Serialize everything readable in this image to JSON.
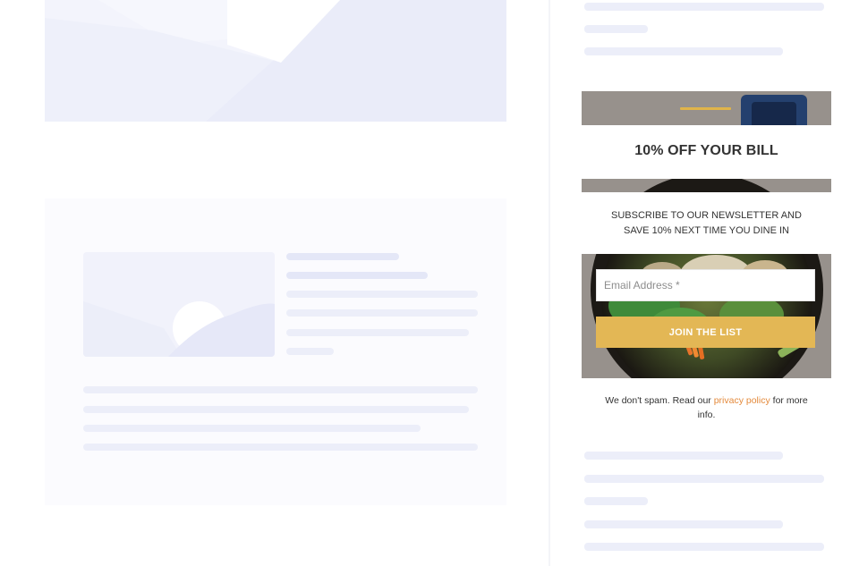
{
  "newsletter": {
    "title": "10% OFF YOUR BILL",
    "subtitle": "SUBSCRIBE TO OUR NEWSLETTER AND SAVE 10% NEXT TIME YOU DINE IN",
    "email_placeholder": "Email Address *",
    "email_value": "",
    "join_label": "JOIN THE LIST",
    "footnote_prefix": "We don't spam. Read our ",
    "privacy_link": "privacy policy",
    "footnote_suffix": " for more info.",
    "colors": {
      "accent": "#e0b44a",
      "button": "#e3b755",
      "link": "#e48a3c"
    }
  }
}
